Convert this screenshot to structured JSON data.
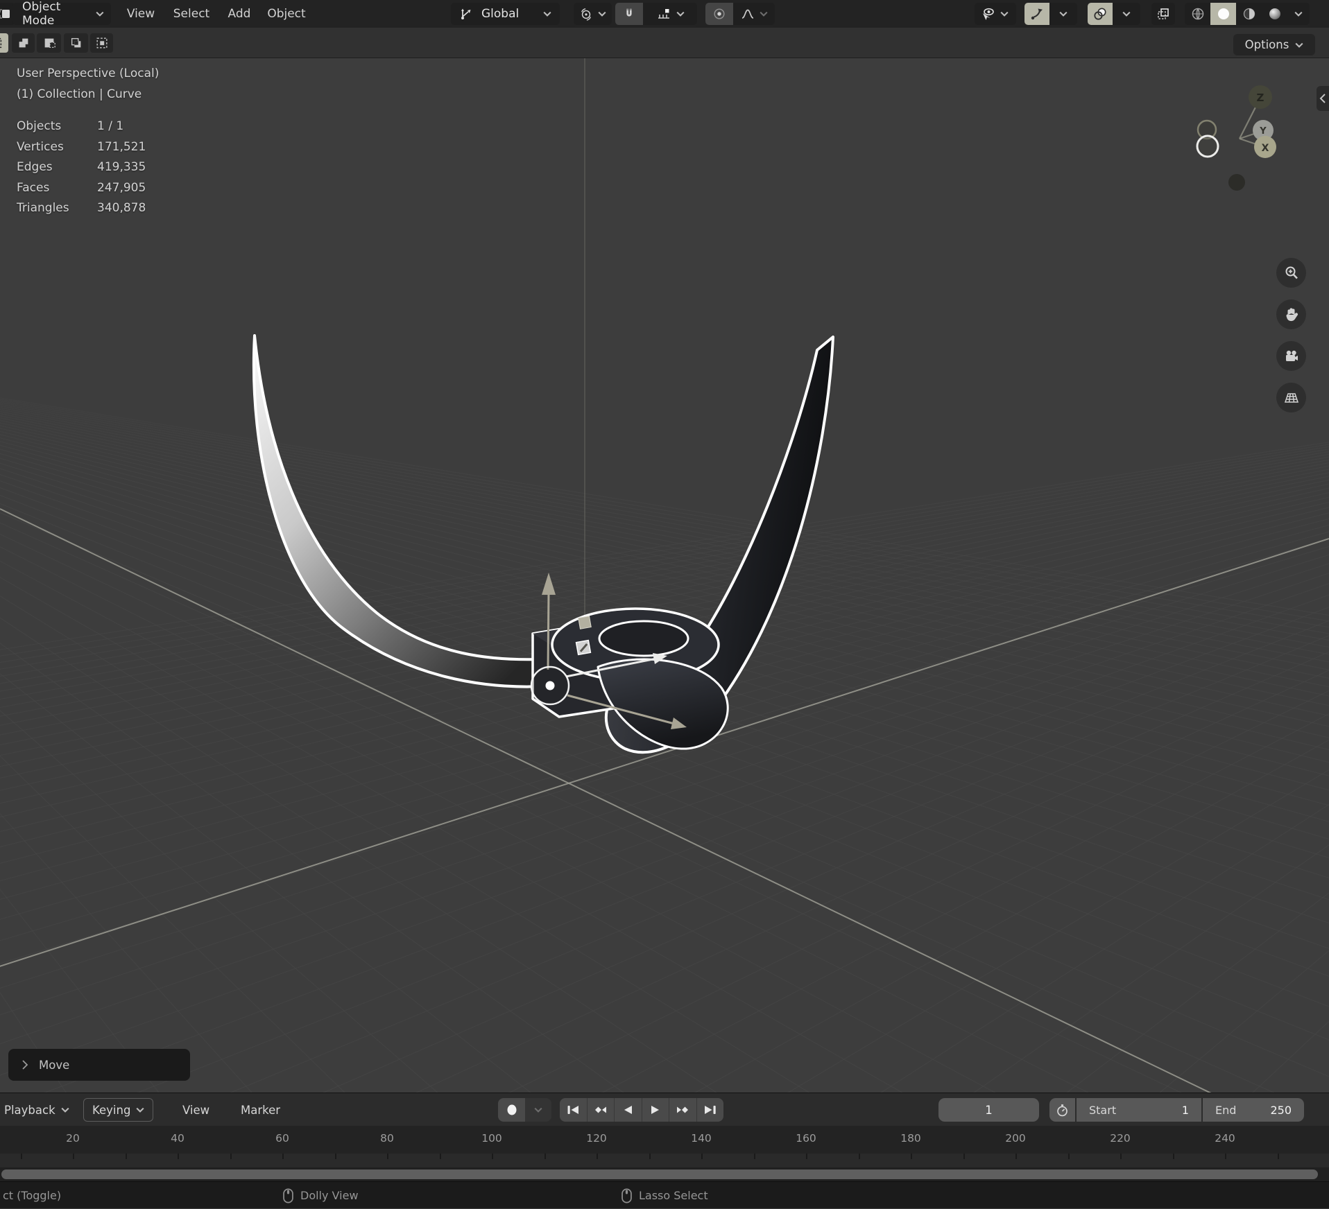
{
  "header": {
    "mode": "Object Mode",
    "menus": [
      "View",
      "Select",
      "Add",
      "Object"
    ],
    "orientation": "Global"
  },
  "tool_settings": {
    "options_label": "Options"
  },
  "viewport": {
    "title": "User Perspective (Local)",
    "subtitle": "(1) Collection | Curve",
    "stats": [
      {
        "label": "Objects",
        "value": "1 / 1"
      },
      {
        "label": "Vertices",
        "value": "171,521"
      },
      {
        "label": "Edges",
        "value": "419,335"
      },
      {
        "label": "Faces",
        "value": "247,905"
      },
      {
        "label": "Triangles",
        "value": "340,878"
      }
    ],
    "axis_gizmo": {
      "x": "X",
      "y": "Y",
      "z": "Z"
    }
  },
  "operator_panel": {
    "label": "Move"
  },
  "timeline": {
    "menus": [
      {
        "label": "Playback",
        "has_dropdown": true
      },
      {
        "label": "Keying",
        "has_dropdown": true
      },
      {
        "label": "View",
        "has_dropdown": false
      },
      {
        "label": "Marker",
        "has_dropdown": false
      }
    ],
    "current_frame": "1",
    "start": {
      "label": "Start",
      "value": "1"
    },
    "end": {
      "label": "End",
      "value": "250"
    },
    "ruler_labels": [
      "20",
      "40",
      "60",
      "80",
      "100",
      "120",
      "140",
      "160",
      "180",
      "200",
      "220",
      "240"
    ]
  },
  "status_bar": {
    "items": [
      {
        "label": "ct (Toggle)"
      },
      {
        "label": "Dolly View"
      },
      {
        "label": "Lasso Select"
      }
    ]
  },
  "colors": {
    "header_bg": "#232323",
    "toolbar_bg": "#313131",
    "viewport_bg": "#3d3d3d",
    "accent_highlight": "#b7b7a8",
    "selection_outline": "#ffffff",
    "grid_line": "#484848",
    "axis_line": "#9d9d93",
    "timeline_bg": "#2c2c2c",
    "field_bg": "#585858",
    "status_bg": "#1b1b1b"
  }
}
